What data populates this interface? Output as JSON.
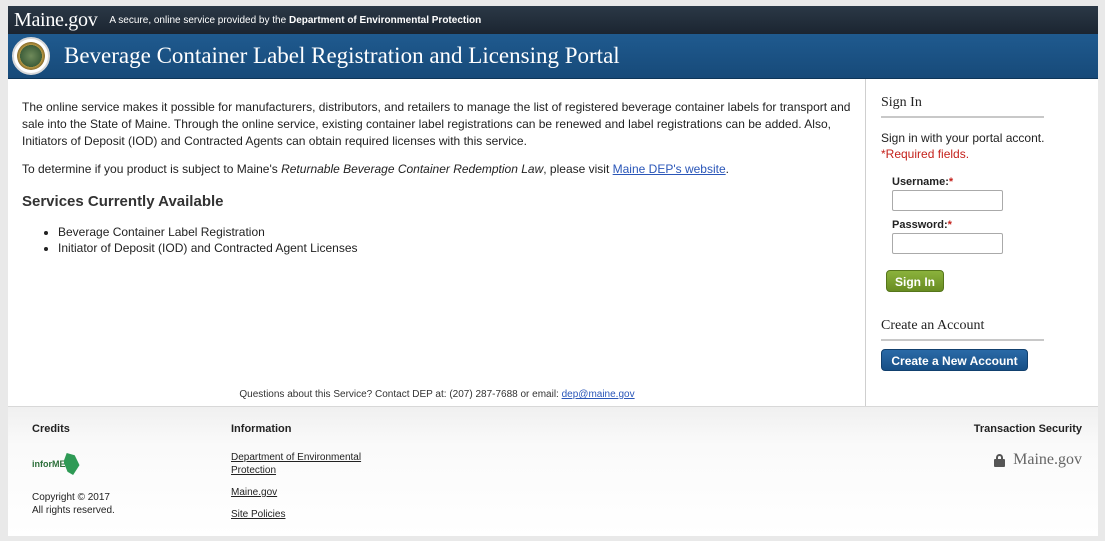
{
  "header": {
    "logo": "Maine.gov",
    "tagline_prefix": "A secure, online service provided by the",
    "tagline_org": "Department of Environmental Protection",
    "banner_title": "Beverage Container Label Registration and Licensing Portal"
  },
  "main": {
    "intro": "The online service makes it possible for manufacturers, distributors, and retailers to manage the list of registered beverage container labels for transport and sale into the State of Maine. Through the online service, existing container label registrations can be renewed and label registrations can be added. Also, Initiators of Deposit (IOD) and Contracted Agents can obtain required licenses with this service.",
    "determine_prefix": "To determine if you product is subject to Maine's ",
    "determine_law": "Returnable Beverage Container Redemption Law",
    "determine_mid": ", please visit ",
    "determine_link": "Maine DEP's website",
    "determine_suffix": ".",
    "services_heading": "Services Currently Available",
    "services": [
      "Beverage Container Label Registration",
      "Initiator of Deposit (IOD) and Contracted Agent Licenses"
    ],
    "question_prefix": "Questions about this Service? Contact DEP at: (207) 287-7688 or email: ",
    "question_email": "dep@maine.gov"
  },
  "sidebar": {
    "signin_heading": "Sign In",
    "signin_text": "Sign in with your portal accont.",
    "required_text": "*Required fields.",
    "username_label": "Username:",
    "password_label": "Password:",
    "required_star": "*",
    "signin_button": "Sign In",
    "create_heading": "Create an Account",
    "create_button": "Create a New Account"
  },
  "footer": {
    "credits_heading": "Credits",
    "informe": "inforME",
    "copyright": "Copyright © 2017",
    "rights": "All rights reserved.",
    "info_heading": "Information",
    "links": [
      "Department of Environmental Protection",
      "Maine.gov",
      "Site Policies"
    ],
    "security_heading": "Transaction Security",
    "security_logo": "Maine.gov"
  },
  "colors": {
    "banner": "#1f5a8f",
    "signin_button": "#7aa02f",
    "create_button": "#1f5d98",
    "required": "#c4211b",
    "link": "#2a56b8"
  }
}
